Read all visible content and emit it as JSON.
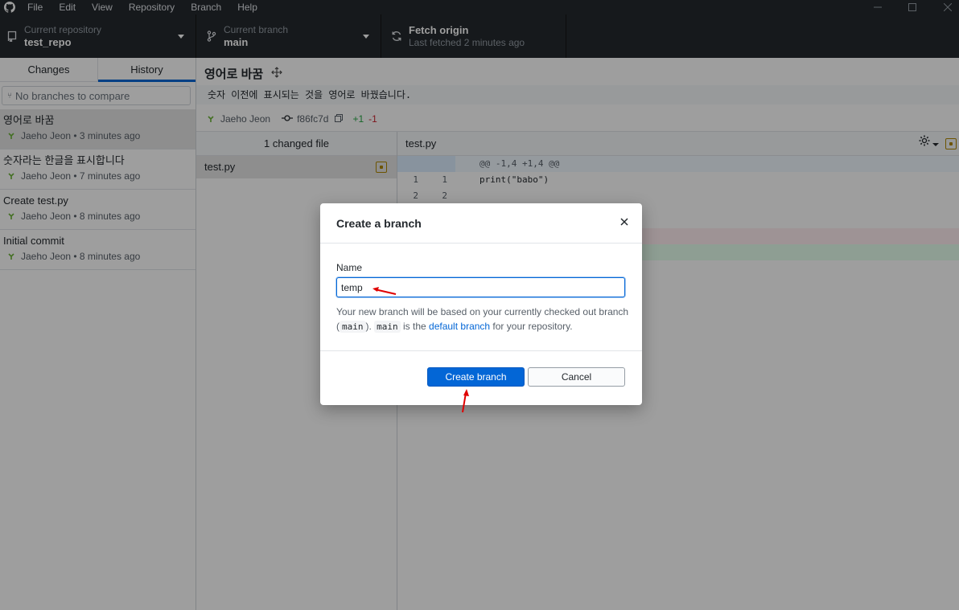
{
  "menu": [
    "File",
    "Edit",
    "View",
    "Repository",
    "Branch",
    "Help"
  ],
  "toolbar": {
    "repo_label": "Current repository",
    "repo_value": "test_repo",
    "branch_label": "Current branch",
    "branch_value": "main",
    "fetch_label": "Fetch origin",
    "fetch_sub": "Last fetched 2 minutes ago"
  },
  "sidebar": {
    "tab_changes": "Changes",
    "tab_history": "History",
    "compare_placeholder": "No branches to compare",
    "commits": [
      {
        "title": "영어로 바꿈",
        "meta": "Jaeho Jeon • 3 minutes ago"
      },
      {
        "title": "숫자라는 한글을 표시합니다",
        "meta": "Jaeho Jeon • 7 minutes ago"
      },
      {
        "title": "Create test.py",
        "meta": "Jaeho Jeon • 8 minutes ago"
      },
      {
        "title": "Initial commit",
        "meta": "Jaeho Jeon • 8 minutes ago"
      }
    ]
  },
  "commit": {
    "summary": "영어로 바꿈",
    "description": "숫자 이전에 표시되는 것을 영어로 바꿨습니다.",
    "author": "Jaeho Jeon",
    "sha": "f86fc7d",
    "added": "+1",
    "removed": "-1"
  },
  "files": {
    "header": "1 changed file",
    "items": [
      "test.py"
    ]
  },
  "diff": {
    "file": "test.py",
    "hunk": "@@ -1,4 +1,4 @@",
    "lines": [
      {
        "old": "1",
        "new": "1",
        "code": "print(\"babo\")"
      },
      {
        "old": "2",
        "new": "2",
        "code": ""
      }
    ]
  },
  "dialog": {
    "title": "Create a branch",
    "name_label": "Name",
    "name_value": "temp",
    "help_1": "Your new branch will be based on your currently checked out branch (",
    "help_code_1": "main",
    "help_2": "). ",
    "help_code_2": "main",
    "help_3": " is the ",
    "help_link": "default branch",
    "help_4": " for your repository.",
    "create_button": "Create branch",
    "cancel_button": "Cancel"
  }
}
